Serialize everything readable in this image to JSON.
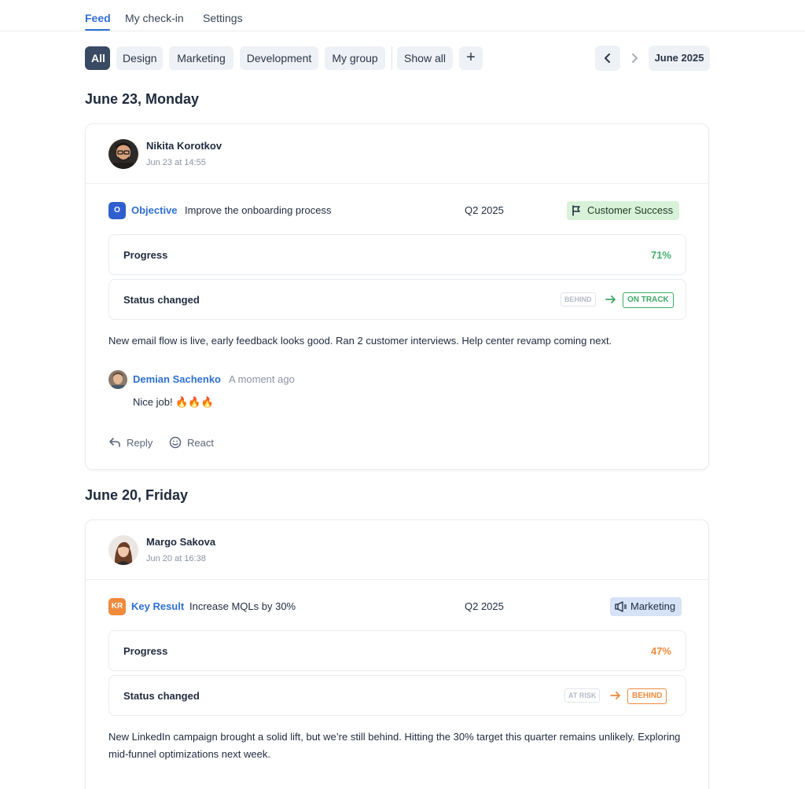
{
  "tabs": [
    {
      "label": "Feed",
      "active": true
    },
    {
      "label": "My check-in",
      "active": false
    },
    {
      "label": "Settings",
      "active": false
    }
  ],
  "filters": {
    "chips": [
      {
        "label": "All",
        "active": true
      },
      {
        "label": "Design",
        "active": false
      },
      {
        "label": "Marketing",
        "active": false
      },
      {
        "label": "Development",
        "active": false
      },
      {
        "label": "My group",
        "active": false
      }
    ],
    "show_all": "Show all",
    "add": "+"
  },
  "period": {
    "month": "June 2025",
    "prev_icon": "chevron-left-icon",
    "next_icon": "chevron-right-icon"
  },
  "days": [
    {
      "date": "June 23, Monday",
      "post": {
        "author": "Nikita Korotkov",
        "time": "Jun 23 at 14:55",
        "badge": "O",
        "badge_color": "#2f5fce",
        "item_type": "Objective",
        "item_title": "Improve the onboarding process",
        "quarter": "Q2 2025",
        "tag": {
          "label": "Customer Success",
          "icon": "flag-icon",
          "bg": "#d8f2d9",
          "color": "#1f3a26"
        },
        "progress_label": "Progress",
        "progress_value": "71%",
        "progress_color": "#3fb06b",
        "status_label": "Status changed",
        "status_from": "BEHIND",
        "status_to": "ON TRACK",
        "status_color": "#3fa865",
        "note": "New email flow is live, early feedback looks good. Ran 2 customer interviews. Help center revamp coming next.",
        "comment": {
          "author": "Demian Sachenko",
          "time": "A moment ago",
          "text": "Nice job! 🔥🔥🔥"
        },
        "actions": {
          "reply": "Reply",
          "react": "React"
        }
      }
    },
    {
      "date": "June 20, Friday",
      "post": {
        "author": "Margo Sakova",
        "time": "Jun 20 at 16:38",
        "badge": "KR",
        "badge_color": "#ef8a3c",
        "item_type": "Key Result",
        "item_title": "Increase MQLs by 30%",
        "quarter": "Q2 2025",
        "tag": {
          "label": "Marketing",
          "icon": "megaphone-icon",
          "bg": "#d6e2f6",
          "color": "#1f2a3d"
        },
        "progress_label": "Progress",
        "progress_value": "47%",
        "progress_color": "#ef8a3c",
        "status_label": "Status changed",
        "status_from": "AT RISK",
        "status_to": "BEHIND",
        "status_color": "#ef8a3c",
        "note": "New LinkedIn campaign brought a solid lift, but we’re still behind. Hitting the 30% target this quarter remains unlikely. Exploring mid-funnel optimizations next week."
      }
    }
  ]
}
